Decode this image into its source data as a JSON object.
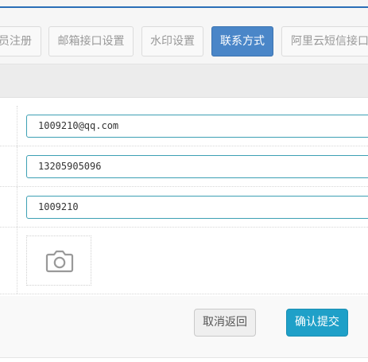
{
  "tabs": [
    {
      "label": "员注册",
      "active": false
    },
    {
      "label": "邮箱接口设置",
      "active": false
    },
    {
      "label": "水印设置",
      "active": false
    },
    {
      "label": "联系方式",
      "active": true
    },
    {
      "label": "阿里云短信接口",
      "active": false
    }
  ],
  "form": {
    "email": {
      "value": "1009210@qq.com"
    },
    "phone": {
      "value": "13205905096"
    },
    "qq": {
      "value": "1009210"
    },
    "image": {
      "icon": "camera-icon"
    }
  },
  "actions": {
    "back_label": "取消返回",
    "submit_label": "确认提交"
  },
  "colors": {
    "active_tab": "#4a86c8",
    "input_border": "#3da0b4",
    "submit_button": "#1fa0c8"
  }
}
